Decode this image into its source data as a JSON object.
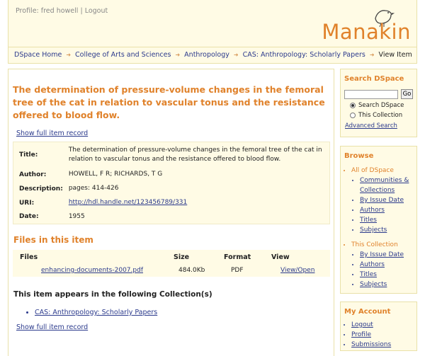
{
  "header": {
    "profile_label": "Profile: fred howell",
    "profile_sep": "|",
    "logout_label": "Logout",
    "logo_text": "Manakin"
  },
  "breadcrumb": {
    "items": [
      "DSpace Home",
      "College of Arts and Sciences",
      "Anthropology",
      "CAS: Anthropology: Scholarly Papers"
    ],
    "current": "View Item"
  },
  "item": {
    "title": "The determination of pressure-volume changes in the femoral tree of the cat in relation to vascular tonus and the resistance offered to blood flow.",
    "show_full_label": "Show full item record",
    "metadata": {
      "title_label": "Title:",
      "title_value": "The determination of pressure-volume changes in the femoral tree of the cat in relation to vascular tonus and the resistance offered to blood flow.",
      "author_label": "Author:",
      "author_value": "HOWELL, F R; RICHARDS, T G",
      "description_label": "Description:",
      "description_value": "pages: 414-426",
      "uri_label": "URI:",
      "uri_value": "http://hdl.handle.net/123456789/331",
      "date_label": "Date:",
      "date_value": "1955"
    },
    "files_heading": "Files in this item",
    "files_headers": {
      "files": "Files",
      "size": "Size",
      "format": "Format",
      "view": "View"
    },
    "file": {
      "name": "enhancing-documents-2007.pdf",
      "size": "484.0Kb",
      "format": "PDF",
      "view": "View/Open"
    },
    "collections_heading": "This item appears in the following Collection(s)",
    "collection_link": "CAS: Anthropology: Scholarly Papers",
    "show_full_label_bottom": "Show full item record"
  },
  "sidebar": {
    "search": {
      "heading": "Search DSpace",
      "go_label": "Go",
      "radio_all": "Search DSpace",
      "radio_coll": "This Collection",
      "advanced": "Advanced Search"
    },
    "browse": {
      "heading": "Browse",
      "all_label": "All of DSpace",
      "all_items": [
        "Communities & Collections",
        "By Issue Date",
        "Authors",
        "Titles",
        "Subjects"
      ],
      "coll_label": "This Collection",
      "coll_items": [
        "By Issue Date",
        "Authors",
        "Titles",
        "Subjects"
      ]
    },
    "account": {
      "heading": "My Account",
      "items": [
        "Logout",
        "Profile",
        "Submissions"
      ]
    }
  },
  "colors": {
    "accent": "#e0822b",
    "link": "#2b3a8c",
    "panel": "#fffbe5",
    "border": "#e9e1a8"
  },
  "icons": [
    "bird-logo-icon",
    "breadcrumb-arrow-icon"
  ]
}
